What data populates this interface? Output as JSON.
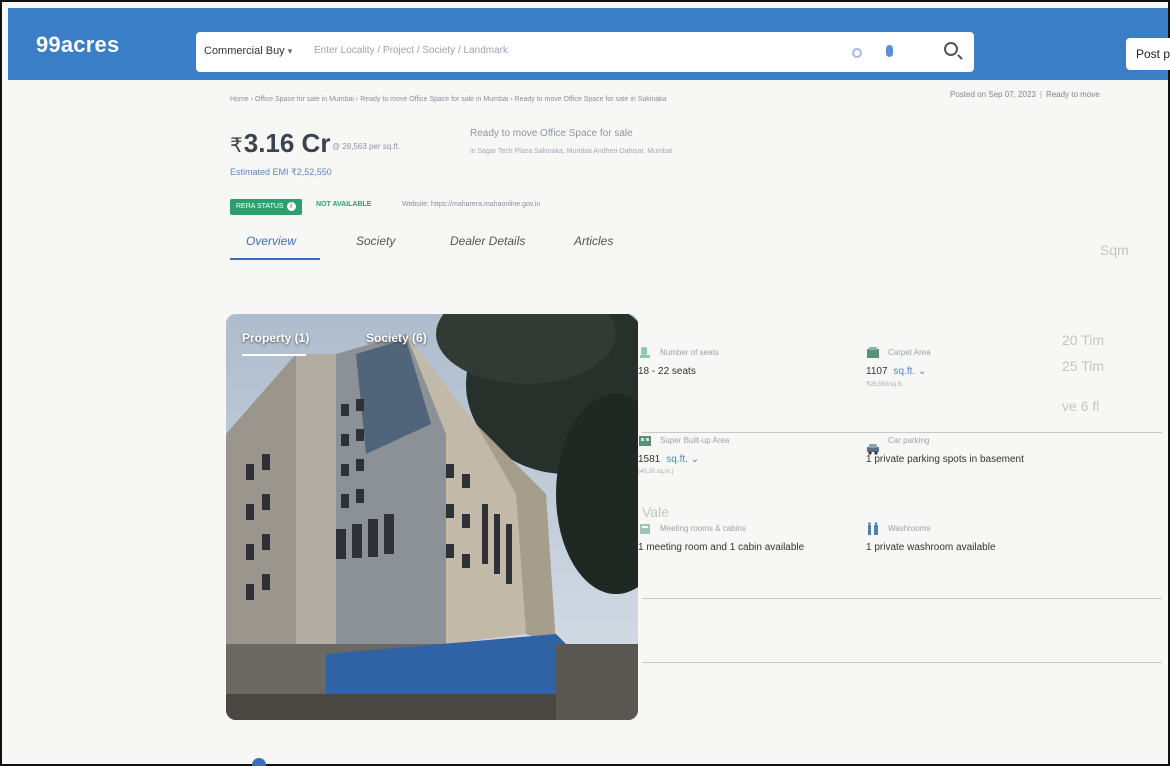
{
  "header": {
    "logo": "99acres",
    "search": {
      "category": "Commercial Buy",
      "placeholder": "Enter Locality / Project / Society / Landmark"
    },
    "post_button": "Post pro"
  },
  "breadcrumb": "Home › Office Space for sale in Mumbai › Ready to move Office Space for sale in Mumbai › Ready to move Office Space for sale in Sakinaka",
  "posted": {
    "date": "Posted on Sep 07, 2023",
    "status": "Ready to move"
  },
  "listing": {
    "price": "3.16 Cr",
    "price_symbol": "₹",
    "price_per_sqft": "@ 28,563 per sq.ft.",
    "emi": "Estimated EMI ₹2,52,550",
    "title": "Ready to move Office Space for sale",
    "subtitle": "in Sagar Tech Plaza Sakinaka, Mumbai Andheri-Dahisar, Mumbai",
    "rera_label": "RERA STATUS",
    "rera_status": "NOT AVAILABLE",
    "rera_website": "Website: https://maharera.mahaonline.gov.in"
  },
  "tabs": [
    "Overview",
    "Society",
    "Dealer Details",
    "Articles"
  ],
  "photo_tabs": [
    "Property (1)",
    "Society (6)"
  ],
  "details": [
    {
      "icon": "seat-icon",
      "label": "Number of seats",
      "value": "18 - 22 seats"
    },
    {
      "icon": "carpet-area-icon",
      "label": "Carpet Area",
      "value": "1107",
      "unit": "sq.ft.",
      "note": "₹28,563/sq.ft."
    },
    {
      "icon": "building-area-icon",
      "label": "Super Built-up Area",
      "value": "1581",
      "unit": "sq.ft.",
      "note": "(40.30 sq.m.)"
    },
    {
      "icon": "car-icon",
      "label": "Car parking",
      "value": "1 private parking spots in basement"
    },
    {
      "icon": "meeting-room-icon",
      "label": "Meeting rooms & cabins",
      "value": "1 meeting room and 1 cabin available"
    },
    {
      "icon": "washroom-icon",
      "label": "Washrooms",
      "value": "1 private washroom available"
    }
  ],
  "colors": {
    "brand": "#3a7ec8",
    "link": "#3a6fc0",
    "rera": "#2f9e6f"
  }
}
